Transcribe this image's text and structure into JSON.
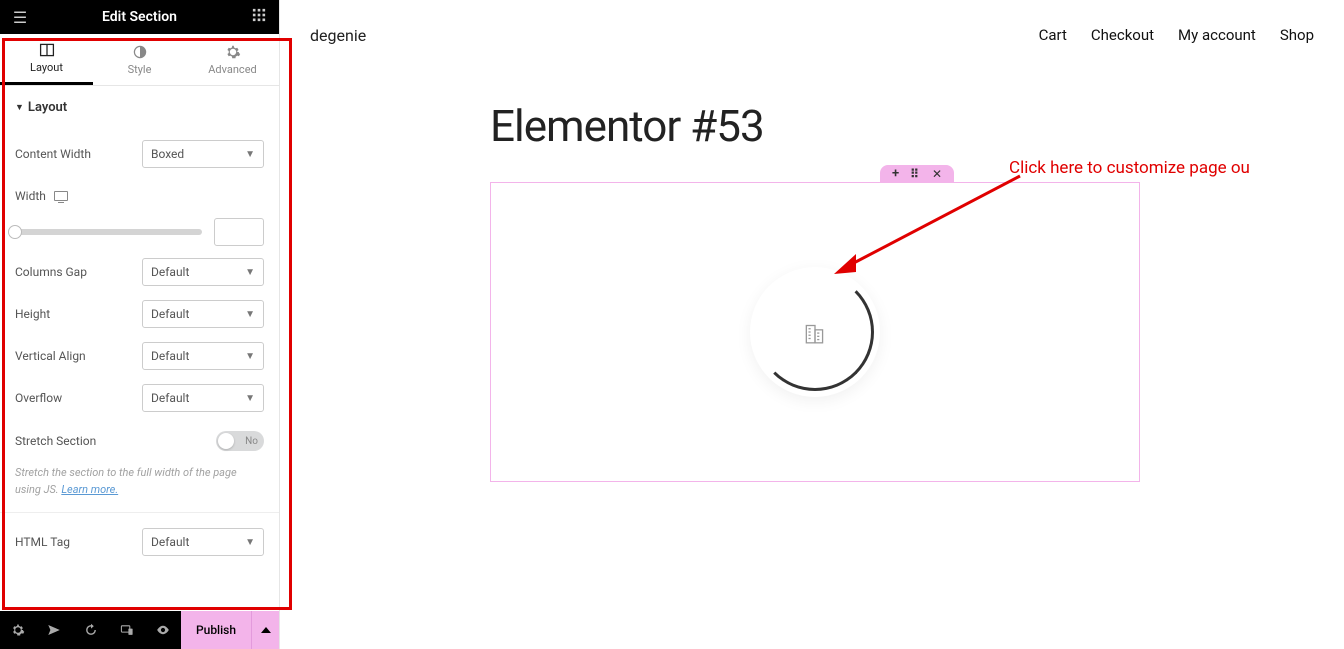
{
  "panel": {
    "title": "Edit Section",
    "tabs": {
      "layout": "Layout",
      "style": "Style",
      "advanced": "Advanced"
    },
    "section_heading": "Layout",
    "controls": {
      "content_width": {
        "label": "Content Width",
        "value": "Boxed"
      },
      "width": {
        "label": "Width"
      },
      "columns_gap": {
        "label": "Columns Gap",
        "value": "Default"
      },
      "height": {
        "label": "Height",
        "value": "Default"
      },
      "vertical_align": {
        "label": "Vertical Align",
        "value": "Default"
      },
      "overflow": {
        "label": "Overflow",
        "value": "Default"
      },
      "stretch": {
        "label": "Stretch Section",
        "toggle_label": "No"
      },
      "stretch_hint_a": "Stretch the section to the full width of the page using JS. ",
      "stretch_hint_link": "Learn more.",
      "html_tag": {
        "label": "HTML Tag",
        "value": "Default"
      }
    },
    "footer": {
      "publish": "Publish"
    }
  },
  "preview": {
    "brand": "degenie",
    "nav": {
      "cart": "Cart",
      "checkout": "Checkout",
      "account": "My account",
      "shop": "Shop"
    },
    "page_title": "Elementor #53"
  },
  "annotation": {
    "text": "Click here to customize page ou"
  }
}
